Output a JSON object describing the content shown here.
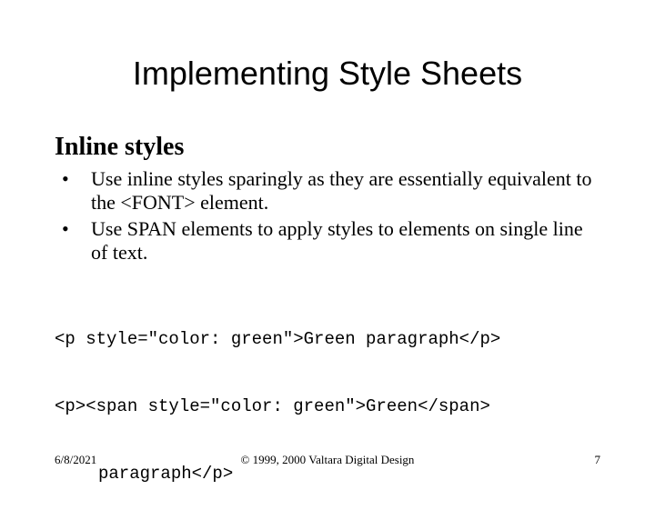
{
  "title": "Implementing Style Sheets",
  "subheading": "Inline styles",
  "bullets": [
    "Use inline styles sparingly as they are essentially equivalent to the <FONT> element.",
    "Use SPAN elements to apply styles to elements on single line of text."
  ],
  "code": {
    "line1": "<p style=\"color: green\">Green paragraph</p>",
    "line2": "<p><span style=\"color: green\">Green</span>",
    "line3": "paragraph</p>"
  },
  "footer": {
    "date": "6/8/2021",
    "copyright": "© 1999, 2000 Valtara Digital Design",
    "page": "7"
  }
}
